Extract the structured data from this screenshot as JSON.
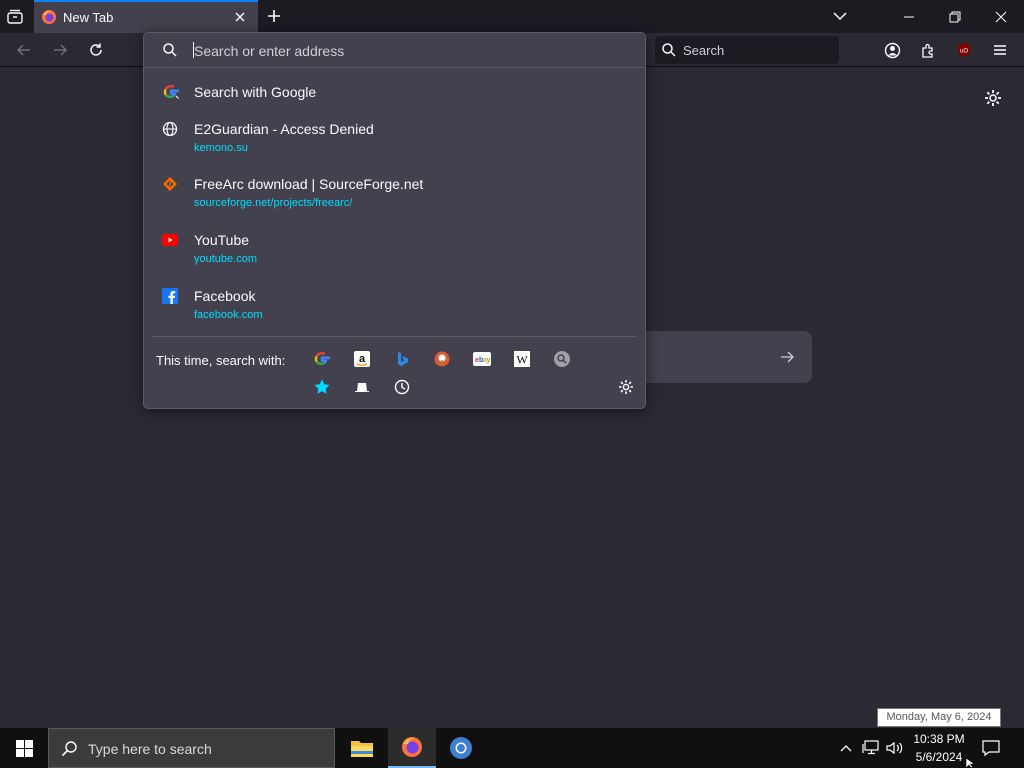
{
  "tab": {
    "title": "New Tab"
  },
  "urlbar": {
    "placeholder": "Search or enter address"
  },
  "searchbar": {
    "placeholder": "Search"
  },
  "dropdown": {
    "heuristic": {
      "title": "Search with Google",
      "icon": "google-icon"
    },
    "results": [
      {
        "title": "E2Guardian - Access Denied",
        "url": "kemono.su",
        "icon": "globe-icon"
      },
      {
        "title": "FreeArc download | SourceForge.net",
        "url": "sourceforge.net/projects/freearc/",
        "icon": "sourceforge-icon"
      },
      {
        "title": "YouTube",
        "url": "youtube.com",
        "icon": "youtube-icon"
      },
      {
        "title": "Facebook",
        "url": "facebook.com",
        "icon": "facebook-icon"
      }
    ],
    "one_off_label": "This time, search with:",
    "one_off_engines": [
      "Google",
      "Amazon",
      "Bing",
      "DuckDuckGo",
      "eBay",
      "Wikipedia",
      "Search",
      "Bookmarks",
      "Tabs",
      "History"
    ]
  },
  "tooltip": {
    "text": "Monday, May 6, 2024"
  },
  "taskbar": {
    "search_placeholder": "Type here to search",
    "time": "10:38 PM",
    "date": "5/6/2024"
  },
  "colors": {
    "accent": "#0a84ff",
    "url": "#00ddff",
    "panel": "#42414d",
    "page": "#2b2a33"
  }
}
